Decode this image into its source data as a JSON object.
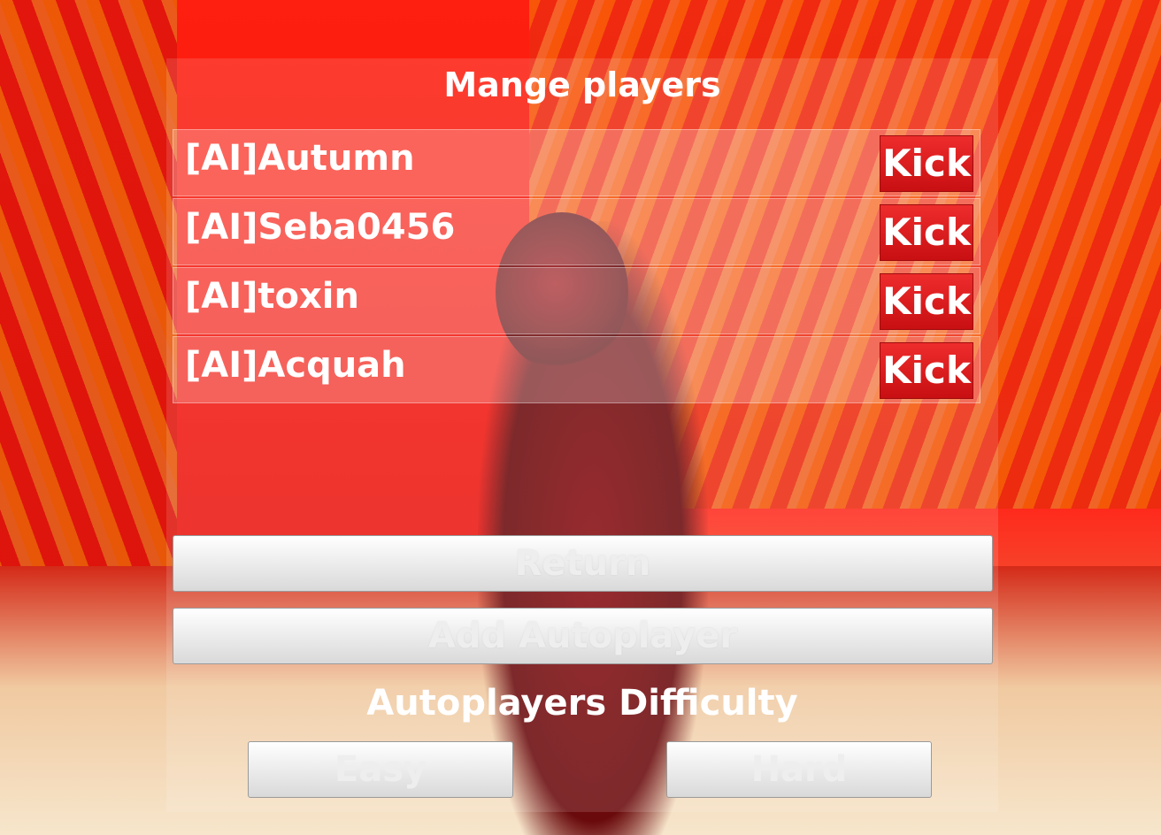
{
  "menu": {
    "title": "Mange players",
    "players": [
      {
        "name": "[AI]Autumn",
        "kick_label": "Kick"
      },
      {
        "name": "[AI]Seba0456",
        "kick_label": "Kick"
      },
      {
        "name": "[AI]toxin",
        "kick_label": "Kick"
      },
      {
        "name": "[AI]Acquah",
        "kick_label": "Kick"
      }
    ],
    "return_label": "Return",
    "add_autoplayer_label": "Add Autoplayer",
    "difficulty_label": "Autoplayers Difficulty",
    "easy_label": "Easy",
    "hard_label": "Hard"
  },
  "colors": {
    "kick_button": "#d81a1c",
    "scene_red": "#e3120f",
    "button_grey": "#e6e6e6"
  }
}
